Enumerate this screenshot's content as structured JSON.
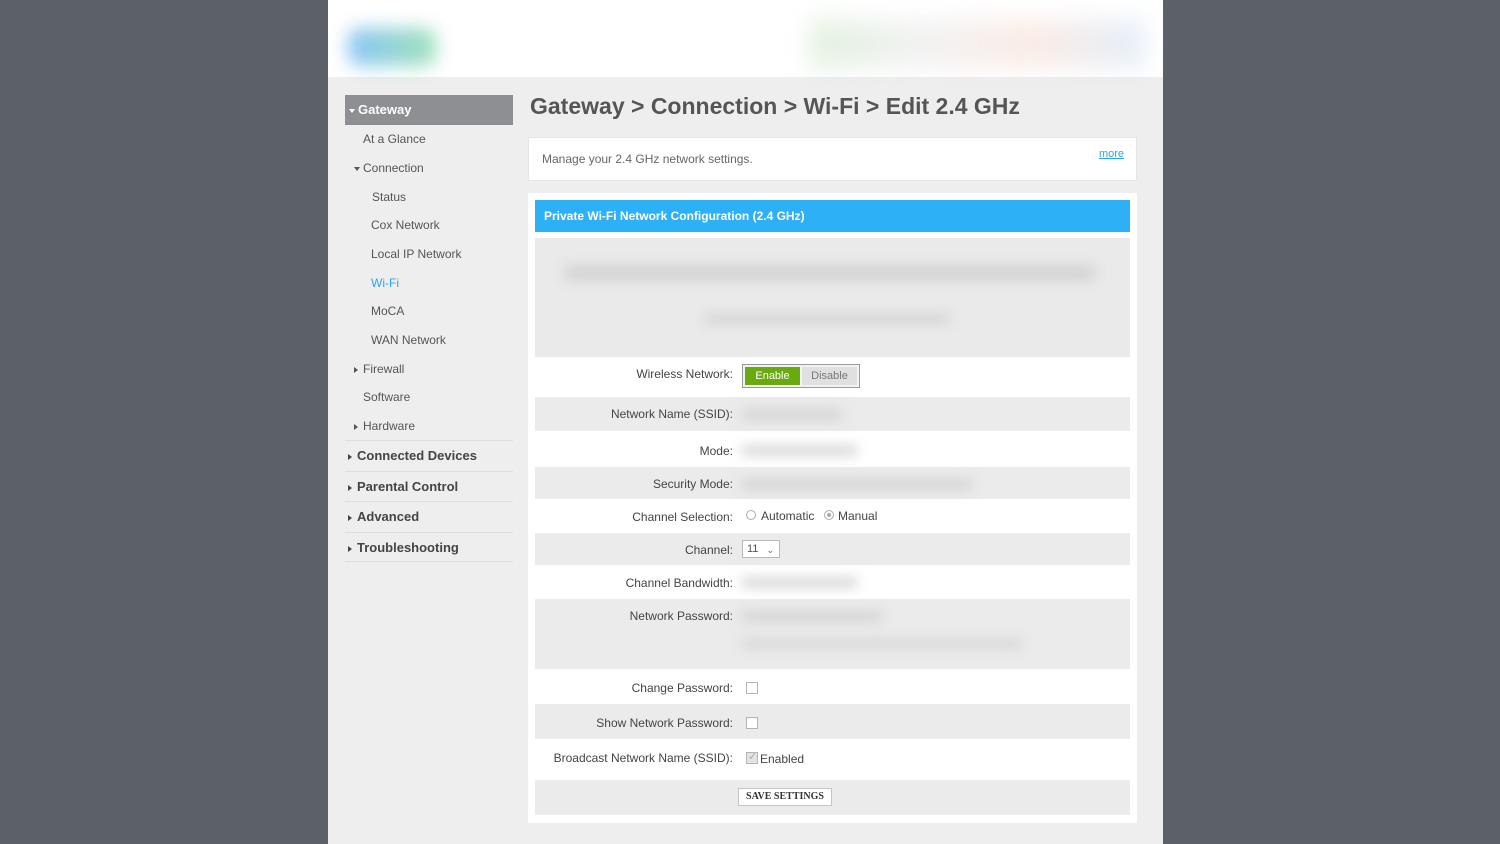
{
  "colors": {
    "accent_blue": "#2eb0f6",
    "enable_green": "#6aaa11",
    "nav_header_gray": "#8e8f93",
    "backdrop": "#5c6169"
  },
  "sidebar": {
    "header": "Gateway",
    "items": {
      "at_a_glance": "At a Glance",
      "connection": "Connection",
      "status": "Status",
      "cox_network": "Cox Network",
      "local_ip_network": "Local IP Network",
      "wifi": "Wi-Fi",
      "moca": "MoCA",
      "wan_network": "WAN Network",
      "firewall": "Firewall",
      "software": "Software",
      "hardware": "Hardware"
    },
    "sections": {
      "connected_devices": "Connected Devices",
      "parental_control": "Parental Control",
      "advanced": "Advanced",
      "troubleshooting": "Troubleshooting"
    }
  },
  "main": {
    "breadcrumb_title": "Gateway > Connection > Wi-Fi > Edit 2.4 GHz",
    "description": "Manage your 2.4 GHz network settings.",
    "more_link": "more",
    "panel_title": "Private Wi-Fi Network Configuration (2.4 GHz)"
  },
  "form": {
    "wireless_network_label": "Wireless Network:",
    "enable_label": "Enable",
    "disable_label": "Disable",
    "ssid_label": "Network Name (SSID):",
    "mode_label": "Mode:",
    "security_mode_label": "Security Mode:",
    "channel_selection_label": "Channel Selection:",
    "channel_automatic": "Automatic",
    "channel_manual": "Manual",
    "channel_label": "Channel:",
    "channel_value": "11",
    "channel_bandwidth_label": "Channel Bandwidth:",
    "network_password_label": "Network Password:",
    "change_password_label": "Change Password:",
    "show_password_label": "Show Network Password:",
    "broadcast_ssid_label": "Broadcast Network Name (SSID):",
    "broadcast_enabled_label": "Enabled",
    "save_button": "SAVE SETTINGS"
  }
}
